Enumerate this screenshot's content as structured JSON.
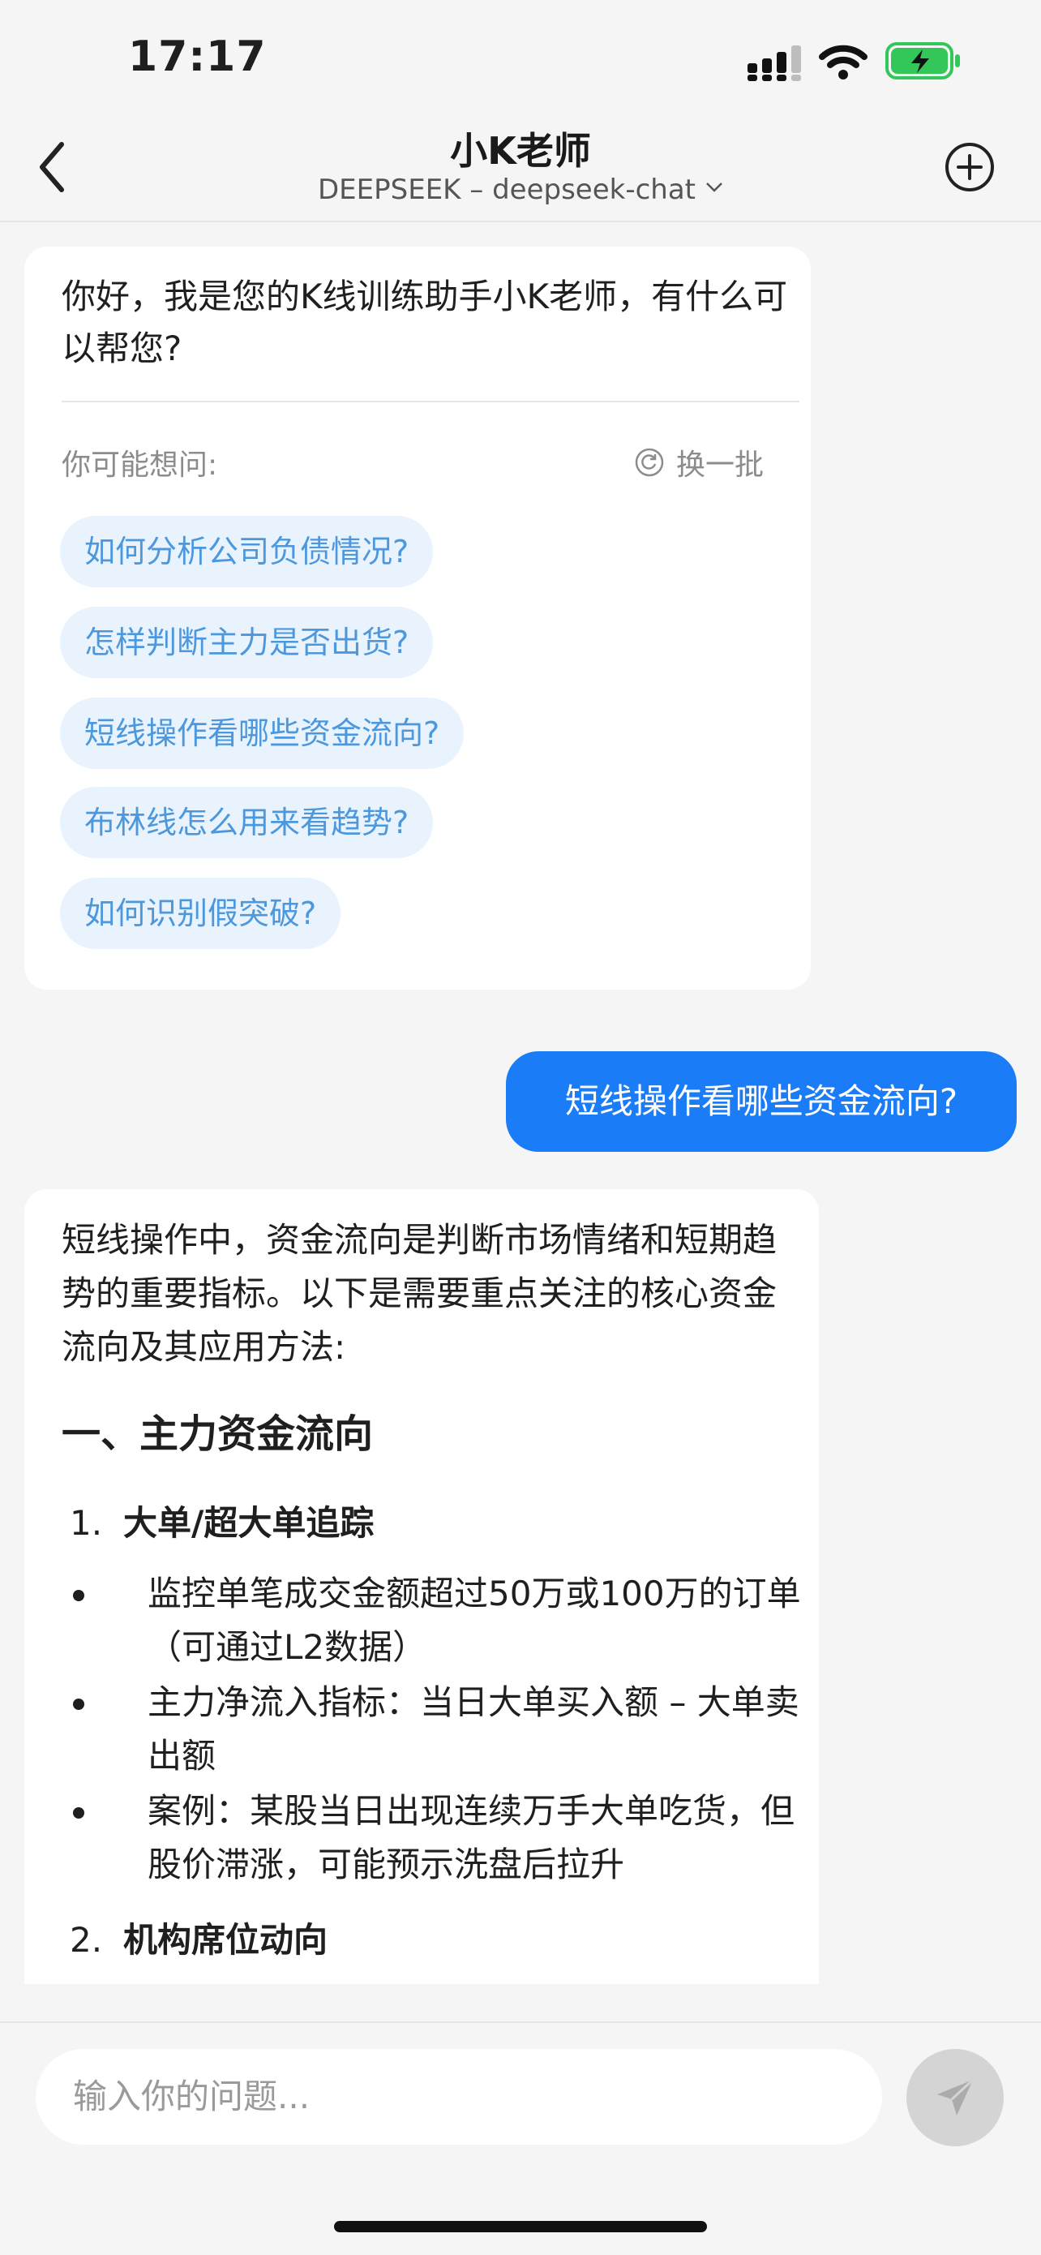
{
  "status": {
    "time": "17:17"
  },
  "nav": {
    "title": "小K老师",
    "subtitle": "DEEPSEEK – deepseek-chat"
  },
  "greeting": {
    "text": "你好，我是您的K线训练助手小K老师，有什么可以帮您?",
    "maybe_label": "你可能想问:",
    "refresh_label": "换一批",
    "suggestions": [
      "如何分析公司负债情况?",
      "怎样判断主力是否出货?",
      "短线操作看哪些资金流向?",
      "布林线怎么用来看趋势?",
      "如何识别假突破?"
    ]
  },
  "user_message": "短线操作看哪些资金流向?",
  "answer": {
    "intro": "短线操作中，资金流向是判断市场情绪和短期趋势的重要指标。以下是需要重点关注的核心资金流向及其应用方法:",
    "heading": "一、主力资金流向",
    "items": [
      {
        "num": "1.",
        "title": "大单/超大单追踪"
      },
      {
        "num": "2.",
        "title": "机构席位动向"
      }
    ],
    "bullets": [
      "监控单笔成交金额超过50万或100万的订单（可通过L2数据）",
      "主力净流入指标：当日大单买入额 – 大单卖出额",
      "案例：某股当日出现连续万手大单吃货，但股价滞涨，可能预示洗盘后拉升"
    ]
  },
  "input": {
    "placeholder": "输入你的问题..."
  },
  "colors": {
    "accent": "#1a7cf6",
    "chip_bg": "#e8f3fd",
    "chip_text": "#4d97dc",
    "battery": "#33c759"
  },
  "icons": [
    "back-arrow-icon",
    "chevron-down-icon",
    "plus-circle-icon",
    "refresh-icon",
    "send-icon",
    "signal-icon",
    "wifi-icon",
    "battery-icon"
  ]
}
